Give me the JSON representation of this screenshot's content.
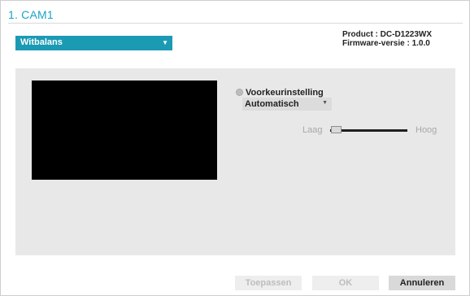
{
  "header": {
    "title": "1. CAM1"
  },
  "main_select": {
    "value": "Witbalans"
  },
  "product": {
    "model": "Product : DC-D1223WX",
    "firmware": "Firmware-versie : 1.0.0"
  },
  "settings": {
    "preset_label": "Voorkeurinstelling",
    "preset_value": "Automatisch",
    "slider_low_label": "Laag",
    "slider_high_label": "Hoog",
    "slider_level": 0.02
  },
  "buttons": {
    "apply": "Toepassen",
    "ok": "OK",
    "cancel": "Annuleren"
  },
  "colors": {
    "accent": "#1aa3c9",
    "select_bg": "#1b9ab4"
  },
  "icons": {
    "dropdown": "chevron-down-icon",
    "radio": "radio-icon"
  }
}
